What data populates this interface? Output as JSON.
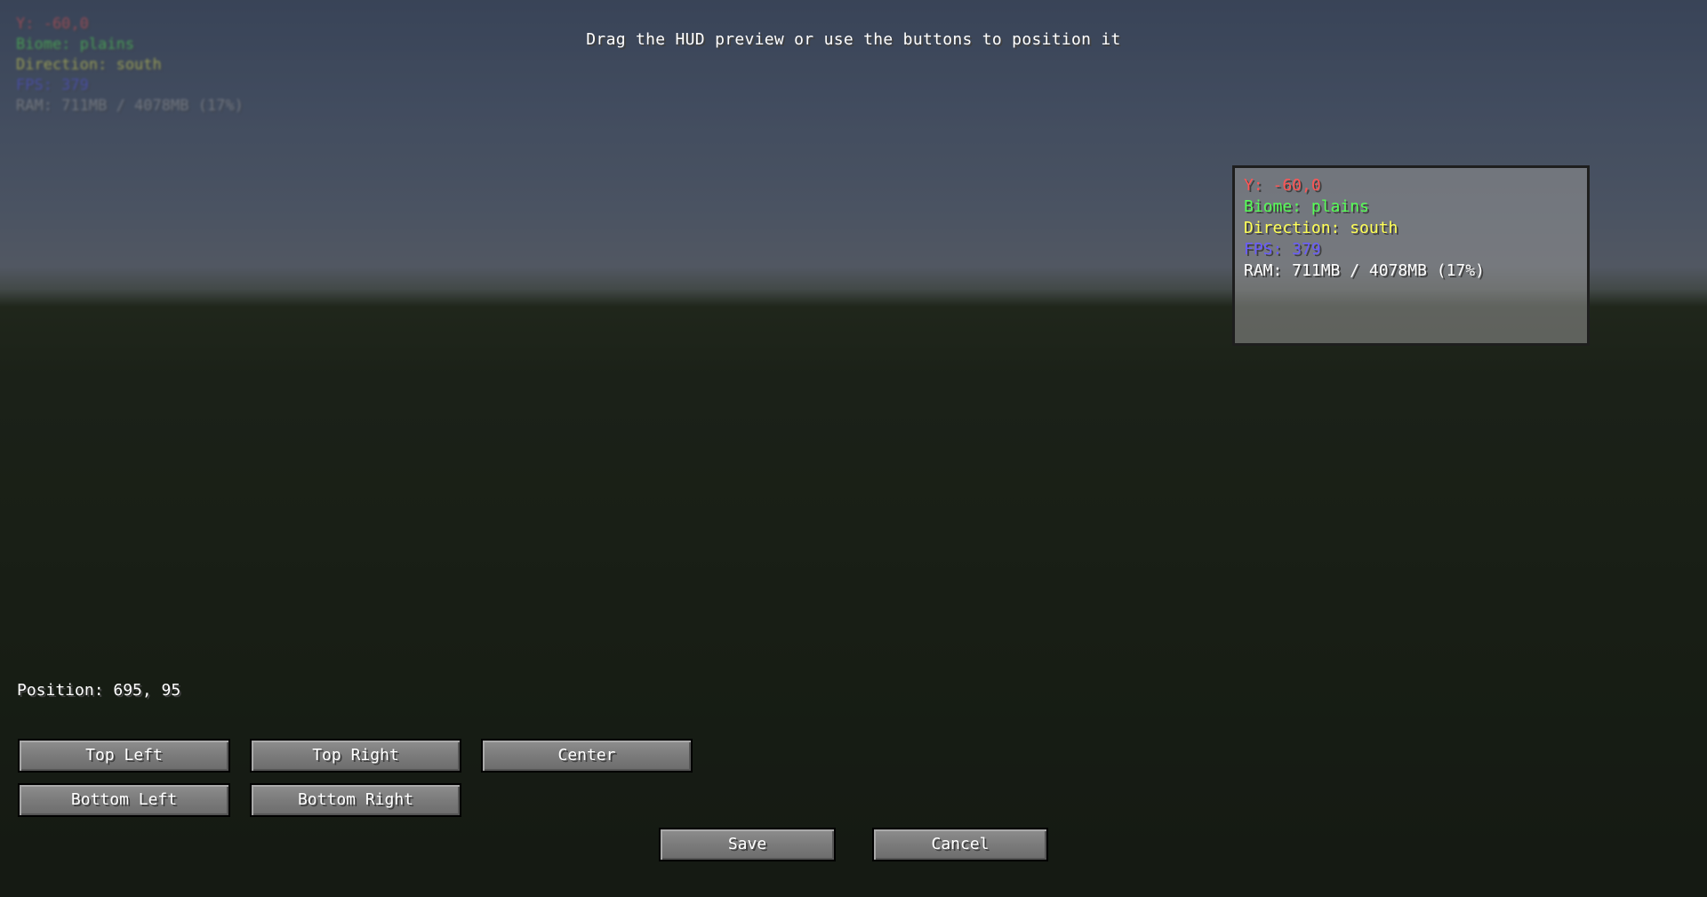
{
  "background_hud": {
    "lines": [
      {
        "text": "Y: -60,0",
        "color": "#ff5555"
      },
      {
        "text": "Biome: plains",
        "color": "#55ff55"
      },
      {
        "text": "Direction: south",
        "color": "#ffff55"
      },
      {
        "text": "FPS: 379",
        "color": "#5555ff"
      },
      {
        "text": "RAM: 711MB / 4078MB (17%)",
        "color": "#aaaaaa"
      }
    ]
  },
  "title": "Drag the HUD preview or use the buttons to position it",
  "hud_preview": {
    "lines": [
      {
        "text": "Y: -60,0",
        "color": "#ff5555"
      },
      {
        "text": "Biome: plains",
        "color": "#55ff55"
      },
      {
        "text": "Direction: south",
        "color": "#ffff55"
      },
      {
        "text": "FPS: 379",
        "color": "#5555ff"
      },
      {
        "text": "RAM: 711MB / 4078MB (17%)",
        "color": "#ffffff"
      }
    ]
  },
  "position_text": "Position: 695, 95",
  "buttons": {
    "top_left": "Top Left",
    "top_right": "Top Right",
    "center": "Center",
    "bottom_left": "Bottom Left",
    "bottom_right": "Bottom Right",
    "save": "Save",
    "cancel": "Cancel"
  }
}
